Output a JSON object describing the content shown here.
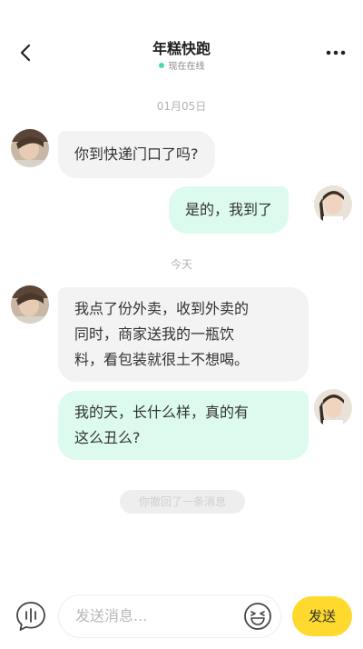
{
  "header": {
    "title": "年糕快跑",
    "status": "现在在线"
  },
  "messages": {
    "date1": "01月05日",
    "m1": "你到快递门口了吗?",
    "m2": "是的，我到了",
    "date2": "今天",
    "m3_line1": "我点了份外卖，收到外卖的",
    "m3_line2": "同时，商家送我的一瓶饮",
    "m3_line3": "料，看包装就很土不想喝。",
    "m4_line1": "我的天，长什么样，真的有",
    "m4_line2": "这么丑么?",
    "recall": "你撤回了一条消息"
  },
  "composer": {
    "placeholder": "发送消息...",
    "send_label": "发送"
  },
  "colors": {
    "accent": "#ffd92e",
    "own_bubble": "#dcfbee",
    "other_bubble": "#f3f3f3",
    "online": "#4fd6b0"
  }
}
